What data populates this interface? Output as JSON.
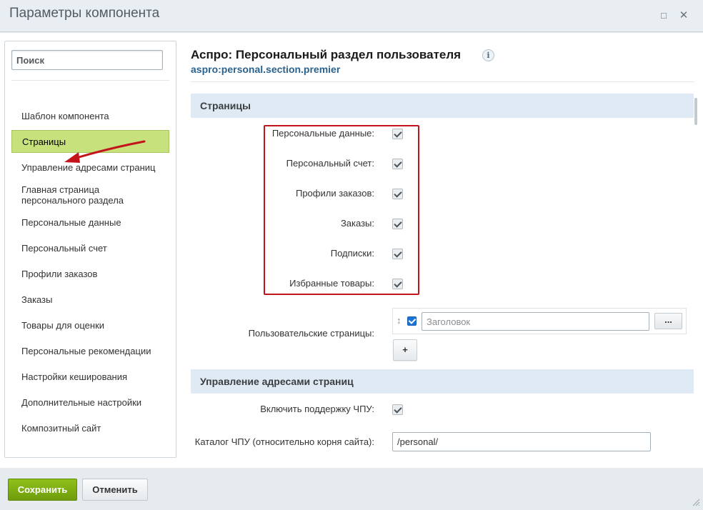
{
  "window": {
    "title": "Параметры компонента",
    "maximize_glyph": "□",
    "close_glyph": "✕"
  },
  "sidebar": {
    "search_placeholder": "Поиск",
    "items": [
      {
        "label": "Шаблон компонента"
      },
      {
        "label": "Страницы",
        "active": true
      },
      {
        "label": "Управление адресами страниц"
      },
      {
        "label": "Главная страница персонального раздела"
      },
      {
        "label": "Персональные данные"
      },
      {
        "label": "Персональный счет"
      },
      {
        "label": "Профили заказов"
      },
      {
        "label": "Заказы"
      },
      {
        "label": "Товары для оценки"
      },
      {
        "label": "Персональные рекомендации"
      },
      {
        "label": "Настройки кеширования"
      },
      {
        "label": "Дополнительные настройки"
      },
      {
        "label": "Композитный сайт"
      }
    ]
  },
  "header": {
    "title": "Аспро: Персональный раздел пользователя",
    "code": "aspro:personal.section.premier",
    "info_glyph": "i"
  },
  "sections": {
    "pages": {
      "title": "Страницы",
      "checkboxes": [
        {
          "label": "Персональные данные:",
          "checked": true
        },
        {
          "label": "Персональный счет:",
          "checked": true
        },
        {
          "label": "Профили заказов:",
          "checked": true
        },
        {
          "label": "Заказы:",
          "checked": true
        },
        {
          "label": "Подписки:",
          "checked": true
        },
        {
          "label": "Избранные товары:",
          "checked": true
        }
      ],
      "custom_pages": {
        "label": "Пользовательские страницы:",
        "drag_glyph": "↕",
        "input_placeholder": "Заголовок",
        "dots_label": "...",
        "add_label": "+"
      }
    },
    "urls": {
      "title": "Управление адресами страниц",
      "sef_label": "Включить поддержку ЧПУ:",
      "sef_checked": true,
      "folder_label": "Каталог ЧПУ (относительно корня сайта):",
      "folder_value": "/personal/"
    }
  },
  "footer": {
    "save_label": "Сохранить",
    "cancel_label": "Отменить"
  },
  "colors": {
    "active_item": "#c7e27c",
    "section_bg": "#dfeaf4",
    "save_button": "#7bad12",
    "annotation_red": "#c3141b"
  }
}
